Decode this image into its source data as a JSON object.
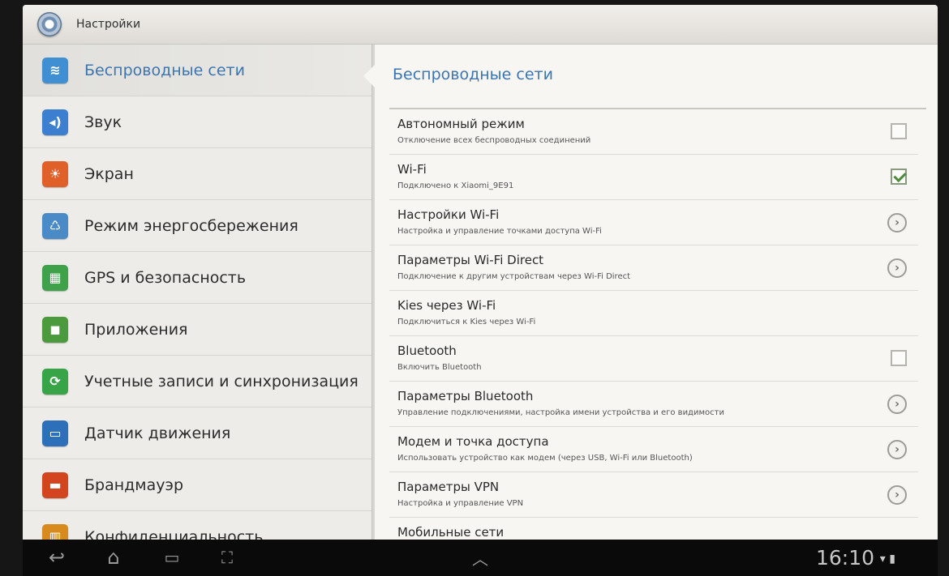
{
  "app": {
    "title": "Настройки",
    "icon": "settings-gear-icon"
  },
  "categories": [
    {
      "label": "Беспроводные сети",
      "icon": "wifi-icon",
      "color": "#3f8fd2",
      "glyph": "≋",
      "selected": true
    },
    {
      "label": "Звук",
      "icon": "speaker-icon",
      "color": "#3c7fd0",
      "glyph": "◂)"
    },
    {
      "label": "Экран",
      "icon": "brightness-icon",
      "color": "#e0602a",
      "glyph": "☀"
    },
    {
      "label": "Режим энергосбережения",
      "icon": "battery-recycle-icon",
      "color": "#4a8ac6",
      "glyph": "♺"
    },
    {
      "label": "GPS и безопасность",
      "icon": "grid-icon",
      "color": "#3fa14a",
      "glyph": "▦"
    },
    {
      "label": "Приложения",
      "icon": "apps-icon",
      "color": "#4c9a3e",
      "glyph": "◼"
    },
    {
      "label": "Учетные записи и синхронизация",
      "icon": "sync-icon",
      "color": "#37a547",
      "glyph": "⟳"
    },
    {
      "label": "Датчик движения",
      "icon": "motion-tablet-icon",
      "color": "#2d6fb8",
      "glyph": "▭"
    },
    {
      "label": "Брандмауэр",
      "icon": "firewall-icon",
      "color": "#d2451f",
      "glyph": "▬"
    },
    {
      "label": "Конфиденциальность",
      "icon": "privacy-icon",
      "color": "#d98a1f",
      "glyph": "▥"
    }
  ],
  "panel": {
    "title": "Беспроводные сети",
    "rows": [
      {
        "title": "Автономный режим",
        "subtitle": "Отключение всех беспроводных соединений",
        "control": "checkbox",
        "checked": false
      },
      {
        "title": "Wi-Fi",
        "subtitle": "Подключено к Xiaomi_9E91",
        "control": "checkbox",
        "checked": true
      },
      {
        "title": "Настройки Wi-Fi",
        "subtitle": "Настройка и управление точками доступа Wi-Fi",
        "control": "chevron"
      },
      {
        "title": "Параметры Wi-Fi Direct",
        "subtitle": "Подключение к другим устройствам через Wi-Fi Direct",
        "control": "chevron"
      },
      {
        "title": "Kies через Wi-Fi",
        "subtitle": "Подключиться к Kies через Wi-Fi",
        "control": "none"
      },
      {
        "title": "Bluetooth",
        "subtitle": "Включить Bluetooth",
        "control": "checkbox",
        "checked": false
      },
      {
        "title": "Параметры Bluetooth",
        "subtitle": "Управление подключениями, настройка имени устройства и его видимости",
        "control": "chevron"
      },
      {
        "title": "Модем и точка доступа",
        "subtitle": "Использовать устройство как модем (через USB, Wi-Fi или Bluetooth)",
        "control": "chevron"
      },
      {
        "title": "Параметры VPN",
        "subtitle": "Настройка и управление VPN",
        "control": "chevron"
      },
      {
        "title": "Мобильные сети",
        "subtitle": "",
        "control": "none"
      }
    ]
  },
  "system_bar": {
    "time": "16:10",
    "buttons": [
      "back-icon",
      "home-icon",
      "recent-apps-icon",
      "screenshot-icon",
      "menu-up-icon"
    ],
    "status": [
      "wifi-signal-icon",
      "battery-icon"
    ]
  },
  "colors": {
    "accent": "#3b75b2"
  }
}
